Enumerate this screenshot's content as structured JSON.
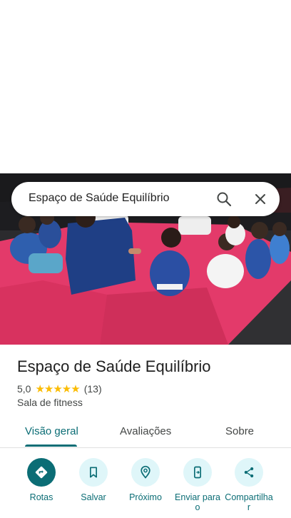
{
  "search": {
    "query": "Espaço de Saúde Equilíbrio"
  },
  "place": {
    "title": "Espaço de Saúde Equilíbrio",
    "rating": "5,0",
    "stars": "★★★★★",
    "reviews": "(13)",
    "category": "Sala de fitness"
  },
  "tabs": [
    {
      "label": "Visão geral",
      "active": true
    },
    {
      "label": "Avaliações",
      "active": false
    },
    {
      "label": "Sobre",
      "active": false
    }
  ],
  "actions": [
    {
      "label": "Rotas",
      "icon": "directions-icon"
    },
    {
      "label": "Salvar",
      "icon": "bookmark-icon"
    },
    {
      "label": "Próximo",
      "icon": "nearby-icon"
    },
    {
      "label": "Enviar para o",
      "icon": "send-to-phone-icon"
    },
    {
      "label": "Compartilha r",
      "icon": "share-icon"
    }
  ],
  "colors": {
    "accent": "#0b6d75",
    "accent_light": "#dff6f9",
    "star": "#fbbc04",
    "mat_pink": "#e33a6a"
  }
}
